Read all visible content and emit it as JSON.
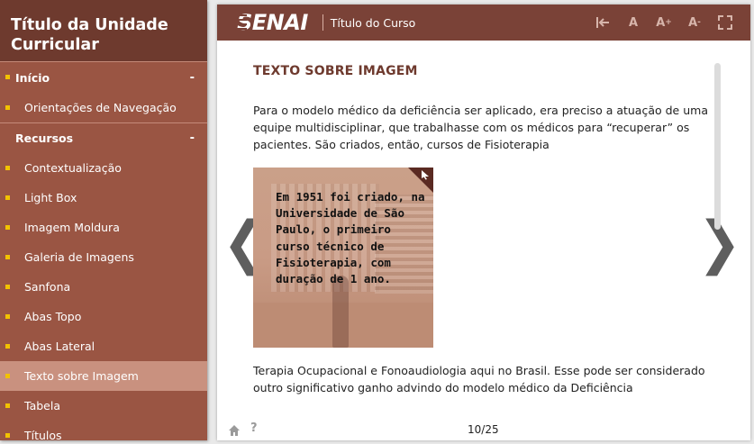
{
  "sidebar": {
    "title": "Título da Unidade Curricular",
    "sections": [
      {
        "label": "Início",
        "toggle": "-"
      },
      {
        "label": "Recursos",
        "toggle": "-"
      }
    ],
    "inicio_items": [
      "Orientações de Navegação"
    ],
    "recursos_items": [
      "Contextualização",
      "Light Box",
      "Imagem Moldura",
      "Galeria de Imagens",
      "Sanfona",
      "Abas Topo",
      "Abas Lateral",
      "Texto sobre Imagem",
      "Tabela",
      "Títulos"
    ],
    "active_item": "Texto sobre Imagem"
  },
  "topbar": {
    "logo": "SENAI",
    "course_title": "Título do Curso",
    "tools": [
      {
        "icon": "collapse-menu-icon",
        "label": "|←"
      },
      {
        "icon": "font-reset-icon",
        "label": "A"
      },
      {
        "icon": "font-increase-icon",
        "label": "A⁺"
      },
      {
        "icon": "font-decrease-icon",
        "label": "A⁻"
      },
      {
        "icon": "fullscreen-icon",
        "label": "⛶"
      }
    ]
  },
  "content": {
    "heading": "TEXTO SOBRE IMAGEM",
    "paragraph1": "Para o modelo médico da deficiência ser aplicado, era preciso a atuação de uma equipe multidisciplinar, que trabalhasse com os médicos para “recuperar” os pacientes. São criados, então, cursos de Fisioterapia",
    "image_overlay_text": "Em 1951 foi criado, na Universidade de São Paulo, o primeiro curso técnico de Fisioterapia, com duração de 1 ano.",
    "paragraph2": "Terapia Ocupacional e Fonoaudiologia aqui no Brasil. Esse pode ser considerado outro significativo ganho advindo do modelo médico da Deficiência"
  },
  "navigation": {
    "prev_glyph": "❮",
    "next_glyph": "❯",
    "help_glyph": "?",
    "page": "10/25"
  },
  "colors": {
    "sidebar_bg": "#9a5543",
    "sidebar_header": "#6e3a2e",
    "topbar": "#7a4237",
    "bullet": "#f2c200",
    "heading": "#6e3a2e"
  }
}
